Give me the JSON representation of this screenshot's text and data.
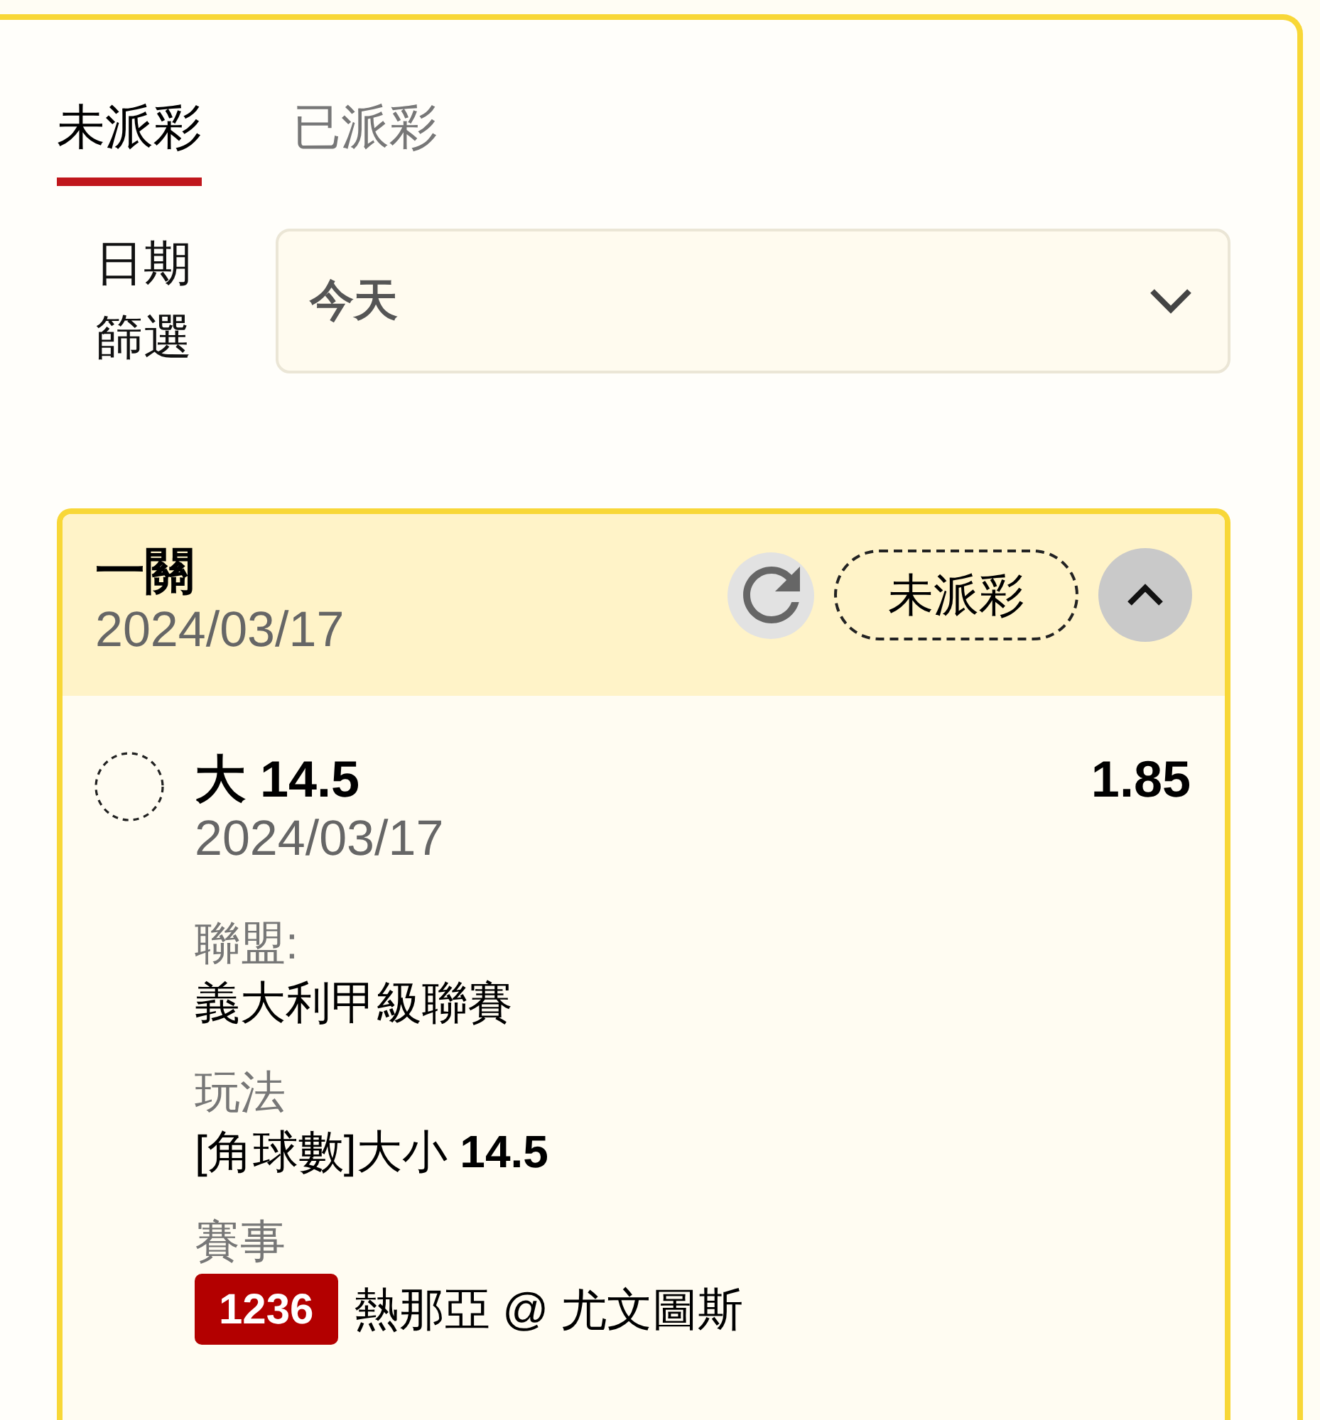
{
  "tabs": [
    {
      "label": "未派彩",
      "selected": true
    },
    {
      "label": "已派彩",
      "selected": false
    }
  ],
  "date_filter": {
    "label": "日期篩選",
    "value": "今天"
  },
  "bet_card": {
    "title": "一關",
    "date": "2024/03/17",
    "status": "未派彩",
    "expanded": true,
    "selection": {
      "pick": "大 14.5",
      "odds": "1.85",
      "date": "2024/03/17",
      "details": [
        {
          "kind": "text",
          "label": "聯盟:",
          "value": "義大利甲級聯賽"
        },
        {
          "kind": "text",
          "label": "玩法",
          "value": "[角球數]大小 **14.5**"
        },
        {
          "kind": "match",
          "label": "賽事",
          "number": "1236",
          "value": "熱那亞 @ 尤文圖斯"
        }
      ]
    }
  }
}
